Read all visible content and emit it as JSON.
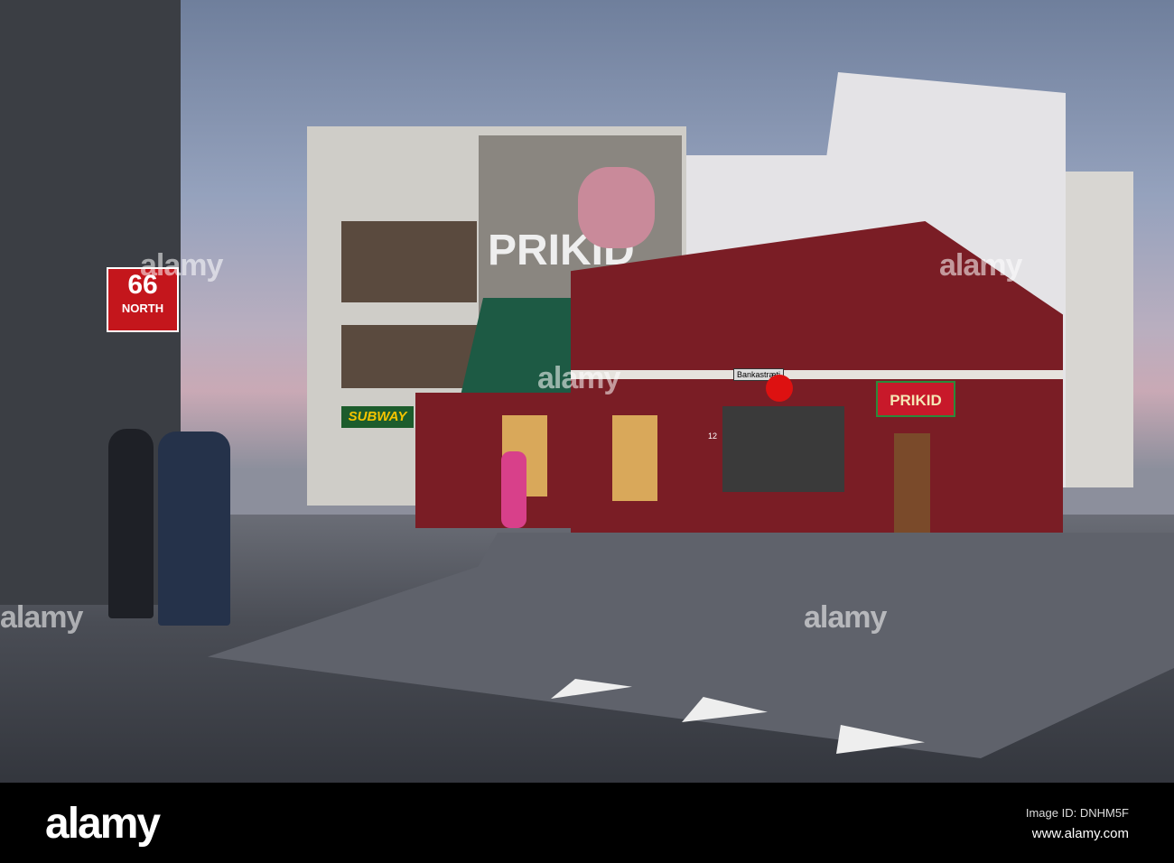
{
  "signs": {
    "north_number": "66",
    "north_label": "NORTH",
    "subway": "SUBWAY",
    "prikid": "PRIKID",
    "street": "Bankastræti",
    "house_number": "12",
    "mural": "PRIKID"
  },
  "watermark": "alamy",
  "footer": {
    "logo": "alamy",
    "image_id": "Image ID: DNHM5F",
    "site": "www.alamy.com"
  },
  "colors": {
    "red_building": "#7a1d25",
    "sky": "#95a2bd",
    "road": "#3a3d44"
  }
}
